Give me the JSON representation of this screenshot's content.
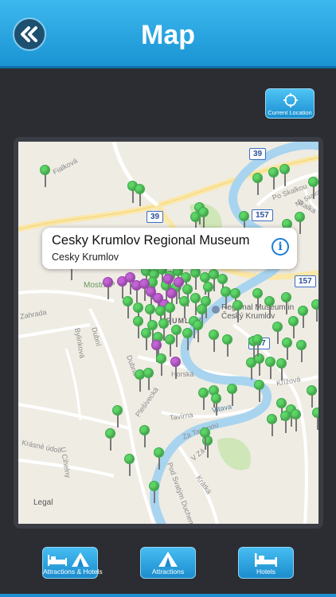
{
  "header": {
    "title": "Map",
    "back_icon": "double-chevron-left-icon"
  },
  "current_location": {
    "label": "Current Location",
    "icon": "crosshair-icon"
  },
  "callout": {
    "title": "Cesky Krumlov Regional Museum",
    "subtitle": "Cesky Krumlov",
    "info_icon": "info-icon",
    "info_glyph": "i"
  },
  "map": {
    "streets": [
      "Fialková",
      "Po Skalkou",
      "Skalka",
      "Na Skalce",
      "Mostní P",
      "Zahrada",
      "Bylinková",
      "Dubní",
      "Dubná",
      "Horská",
      "Křížová",
      "Plešivecká",
      "Vltava",
      "Tavírna",
      "Za Tavírnou",
      "V Zá",
      "Krásné údolí",
      "U Cihelny",
      "Pod Svatým Duchem",
      "Krátká",
      "KRUMLOV"
    ],
    "poi_label": "Regional Museum in Český Krumlov",
    "routes": [
      "39",
      "39",
      "157",
      "157",
      "157"
    ],
    "legal": "Legal",
    "pin_colors": {
      "attraction": "#5cd666",
      "hotel": "#c463d6"
    }
  },
  "tabs": [
    {
      "label": "Attractions & Hotels",
      "icon": "bed-and-tent-icon"
    },
    {
      "label": "Attractions",
      "icon": "tent-icon"
    },
    {
      "label": "Hotels",
      "icon": "bed-icon"
    }
  ]
}
